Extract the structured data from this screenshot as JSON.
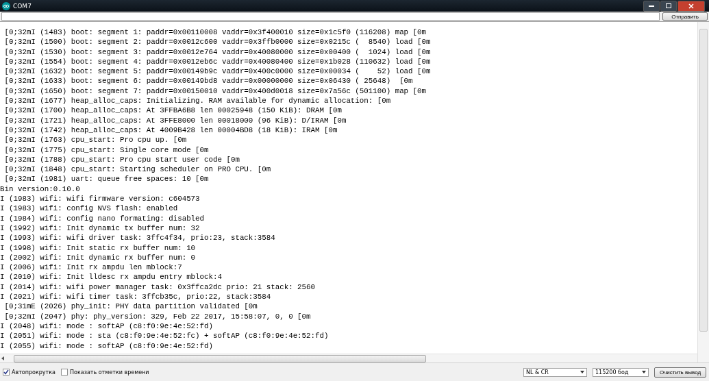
{
  "window": {
    "title": "COM7"
  },
  "send_bar": {
    "button": "Отправить"
  },
  "log_lines": [
    " [0;32mI (1483) boot: segment 1: paddr=0x00110008 vaddr=0x3f400010 size=0x1c5f0 (116208) map [0m",
    " [0;32mI (1500) boot: segment 2: paddr=0x0012c600 vaddr=0x3ffb0000 size=0x0215c (  8540) load [0m",
    " [0;32mI (1530) boot: segment 3: paddr=0x0012e764 vaddr=0x40080000 size=0x00400 (  1024) load [0m",
    " [0;32mI (1554) boot: segment 4: paddr=0x0012eb6c vaddr=0x40080400 size=0x1b028 (110632) load [0m",
    " [0;32mI (1632) boot: segment 5: paddr=0x00149b9c vaddr=0x400c0000 size=0x00034 (    52) load [0m",
    " [0;32mI (1633) boot: segment 6: paddr=0x00149bd8 vaddr=0x00000000 size=0x06430 ( 25648)  [0m",
    " [0;32mI (1650) boot: segment 7: paddr=0x00150010 vaddr=0x400d0018 size=0x7a56c (501100) map [0m",
    " [0;32mI (1677) heap_alloc_caps: Initializing. RAM available for dynamic allocation: [0m",
    " [0;32mI (1700) heap_alloc_caps: At 3FFBA6B8 len 00025948 (150 KiB): DRAM [0m",
    " [0;32mI (1721) heap_alloc_caps: At 3FFE8000 len 00018000 (96 KiB): D/IRAM [0m",
    " [0;32mI (1742) heap_alloc_caps: At 4009B428 len 00004BD8 (18 KiB): IRAM [0m",
    " [0;32mI (1763) cpu_start: Pro cpu up. [0m",
    " [0;32mI (1775) cpu_start: Single core mode [0m",
    " [0;32mI (1788) cpu_start: Pro cpu start user code [0m",
    " [0;32mI (1848) cpu_start: Starting scheduler on PRO CPU. [0m",
    " [0;32mI (1981) uart: queue free spaces: 10 [0m",
    "Bin version:0.10.0",
    "I (1983) wifi: wifi firmware version: c604573",
    "I (1983) wifi: config NVS flash: enabled",
    "I (1984) wifi: config nano formating: disabled",
    "I (1992) wifi: Init dynamic tx buffer num: 32",
    "I (1993) wifi: wifi driver task: 3ffc4f34, prio:23, stack:3584",
    "I (1998) wifi: Init static rx buffer num: 10",
    "I (2002) wifi: Init dynamic rx buffer num: 0",
    "I (2006) wifi: Init rx ampdu len mblock:7",
    "I (2010) wifi: Init lldesc rx ampdu entry mblock:4",
    "I (2014) wifi: wifi power manager task: 0x3ffca2dc prio: 21 stack: 2560",
    "I (2021) wifi: wifi timer task: 3ffcb35c, prio:22, stack:3584",
    " [0;31mE (2026) phy_init: PHY data partition validated [0m",
    " [0;32mI (2047) phy: phy_version: 329, Feb 22 2017, 15:58:07, 0, 0 [0m",
    "I (2048) wifi: mode : softAP (c8:f0:9e:4e:52:fd)",
    "I (2051) wifi: mode : sta (c8:f0:9e:4e:52:fc) + softAP (c8:f0:9e:4e:52:fd)",
    "I (2055) wifi: mode : softAP (c8:f0:9e:4e:52:fd)"
  ],
  "status_bar": {
    "options": [
      {
        "label": "Автопрокрутка",
        "checked": true
      },
      {
        "label": "Показать отметки времени",
        "checked": false
      }
    ],
    "line_ending": "NL & CR",
    "baud_rate": "115200 бод",
    "clear_button": "Очистить вывод"
  }
}
